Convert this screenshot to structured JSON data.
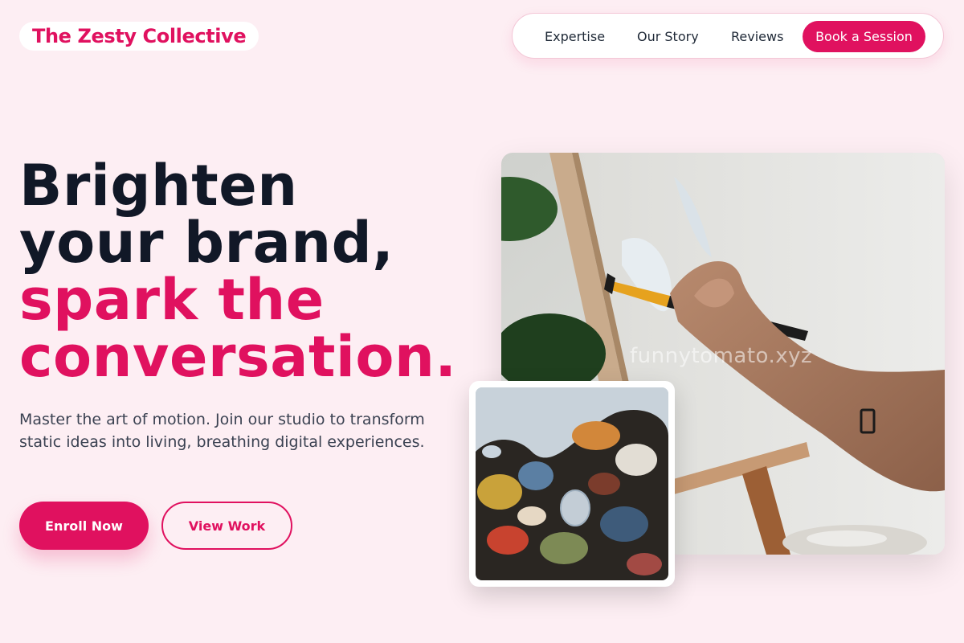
{
  "brand": {
    "name": "The Zesty Collective",
    "accent": "#e0115f"
  },
  "nav": {
    "links": [
      "Expertise",
      "Our Story",
      "Reviews"
    ],
    "cta_label": "Book a Session"
  },
  "hero": {
    "headline_lines_dark": [
      "Brighten",
      "your brand,"
    ],
    "headline_lines_accent": [
      "spark the",
      "conversation."
    ],
    "description": "Master the art of motion. Join our studio to transform static ideas into living, breathing digital experiences.",
    "primary_button": "Enroll Now",
    "secondary_button": "View Work"
  },
  "images": {
    "main": {
      "subject": "painting-on-canvas-photo",
      "watermark": "funnytomato.xyz"
    },
    "secondary": {
      "subject": "paint-palette-photo"
    }
  }
}
